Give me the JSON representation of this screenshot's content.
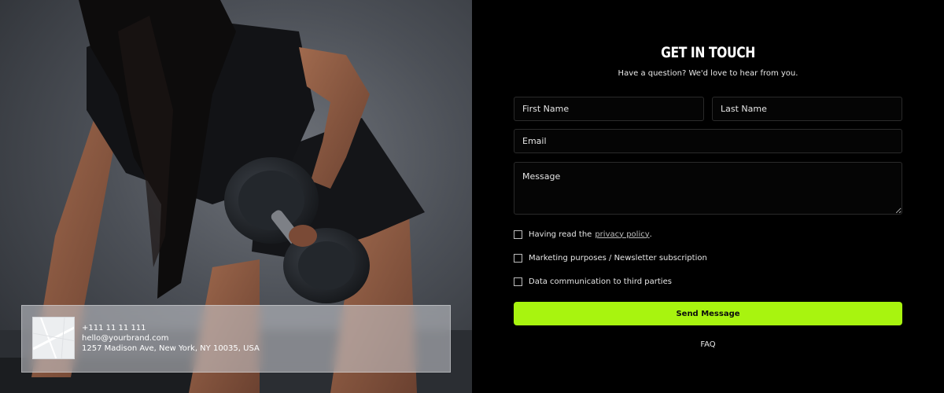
{
  "contact_card": {
    "phone": "+111 11 11 111",
    "email": "hello@yourbrand.com",
    "address": "1257 Madison Ave, New York, NY 10035, USA",
    "map_icon": "map-icon"
  },
  "form": {
    "title": "GET IN TOUCH",
    "subtitle": "Have a question? We'd love to hear from you.",
    "first_name_placeholder": "First Name",
    "last_name_placeholder": "Last Name",
    "email_placeholder": "Email",
    "message_placeholder": "Message",
    "consents": {
      "privacy_prefix": "Having read the",
      "privacy_link": "privacy policy",
      "privacy_suffix": ".",
      "marketing": "Marketing purposes / Newsletter subscription",
      "third_parties": "Data communication to third parties"
    },
    "send_label": "Send Message",
    "faq_label": "FAQ"
  },
  "colors": {
    "accent": "#a8f40f",
    "background": "#000000"
  }
}
